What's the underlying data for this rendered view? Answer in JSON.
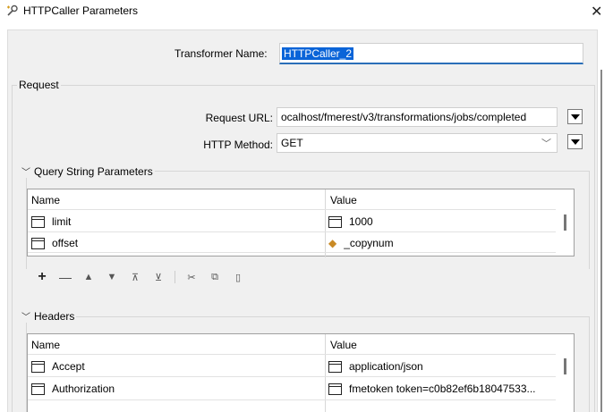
{
  "window": {
    "title": "HTTPCaller Parameters",
    "close_glyph": "✕"
  },
  "transformer": {
    "label": "Transformer Name:",
    "value": "HTTPCaller_2"
  },
  "request": {
    "legend": "Request",
    "url_label": "Request URL:",
    "url_value": "ocalhost/fmerest/v3/transformations/jobs/completed",
    "method_label": "HTTP Method:",
    "method_value": "GET"
  },
  "query_params": {
    "legend": "Query String Parameters",
    "col_name": "Name",
    "col_value": "Value",
    "rows": [
      {
        "name": "limit",
        "value": "1000"
      },
      {
        "name": "offset",
        "value": "_copynum"
      }
    ]
  },
  "toolbar": {
    "icons": [
      "add-icon",
      "remove-icon",
      "move-up-icon",
      "move-down-icon",
      "move-top-icon",
      "move-bottom-icon",
      "cut-icon",
      "copy-icon",
      "paste-icon"
    ]
  },
  "headers": {
    "legend": "Headers",
    "col_name": "Name",
    "col_value": "Value",
    "rows": [
      {
        "name": "Accept",
        "value": "application/json"
      },
      {
        "name": "Authorization",
        "value": "fmetoken token=c0b82ef6b18047533..."
      }
    ]
  },
  "colors": {
    "selection": "#0a64d8",
    "focus_underline": "#2a6fb8",
    "panel_bg": "#f0f0f0",
    "attribute_icon": "#c98a25"
  }
}
